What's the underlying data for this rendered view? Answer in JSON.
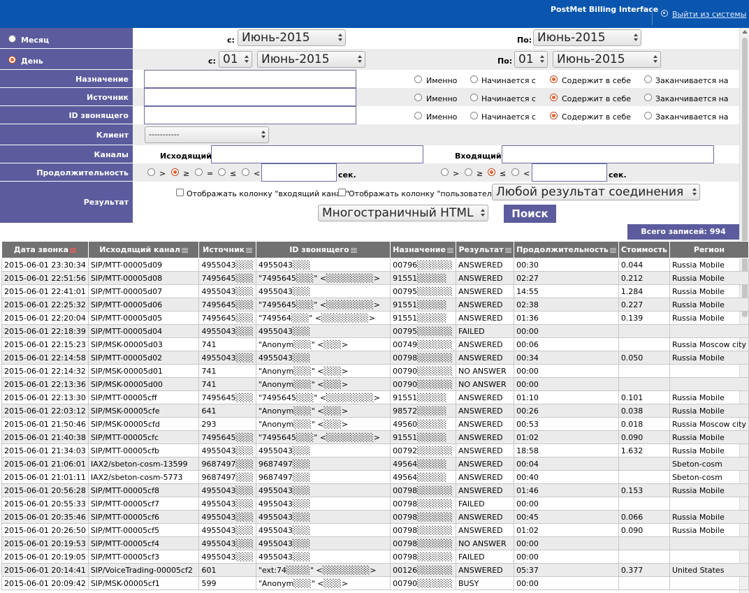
{
  "header": {
    "brand": "PostMet Billing Interface",
    "logout_label": "Выйти из системы"
  },
  "filters": {
    "month": {
      "label": "Месяц",
      "from_label": "с:",
      "from_value": "Июнь-2015",
      "to_label": "По:",
      "to_value": "Июнь-2015"
    },
    "day": {
      "label": "День",
      "from_label": "с:",
      "from_day": "01",
      "from_month": "Июнь-2015",
      "to_label": "По:",
      "to_day": "01",
      "to_month": "Июнь-2015"
    },
    "match_options": [
      "Именно",
      "Начинается с",
      "Содержит в себе",
      "Заканчивается на"
    ],
    "destination_label": "Назначение",
    "source_label": "Источник",
    "caller_id_label": "ID звонящего",
    "client_label": "Клиент",
    "client_value": "-----------",
    "channels_label": "Каналы",
    "outgoing_label": "Исходящий:",
    "incoming_label": "Входящий:",
    "duration_label": "Продолжительность",
    "duration_ops": [
      ">",
      "≥",
      "=",
      "≤",
      "<"
    ],
    "duration_ops2": [
      ">",
      "≥",
      "≤",
      "<"
    ],
    "seconds_label": "сек.",
    "result_label": "Результат",
    "show_incoming_label": "Отображать колонку \"входящий канал\"",
    "show_user_label": "Отображать колонку \"пользователь\"",
    "result_select": "Любой результат соединения",
    "format_select": "Многостраничный HTML",
    "search_button": "Поиск",
    "total_label": "Всего записей: 994"
  },
  "table": {
    "columns": [
      "Дата звонка",
      "Исходящий канал",
      "Источник",
      "ID звонящего",
      "Назначение",
      "Результат",
      "Продолжительность",
      "Стоимость",
      "Регион"
    ],
    "rows": [
      [
        "2015-06-01 23:30:34",
        "SIP/MTT-00005d09",
        "4955043░░░",
        "4955043░░░",
        "00796░░░░░░",
        "ANSWERED",
        "00:30",
        "0.044",
        "Russia Mobile"
      ],
      [
        "2015-06-01 22:51:56",
        "SIP/MTT-00005d08",
        "7495645░░░",
        "\"7495645░░░\" <░░░░░░░░>",
        "91551░░░░░",
        "ANSWERED",
        "02:27",
        "0.212",
        "Russia Mobile"
      ],
      [
        "2015-06-01 22:41:01",
        "SIP/MTT-00005d07",
        "4955043░░░",
        "4955043░░░",
        "00795░░░░░░",
        "ANSWERED",
        "14:55",
        "1.284",
        "Russia Mobile"
      ],
      [
        "2015-06-01 22:25:32",
        "SIP/MTT-00005d06",
        "7495645░░░",
        "\"7495645░░░\" <░░░░░░░░>",
        "91551░░░░░",
        "ANSWERED",
        "02:38",
        "0.227",
        "Russia Mobile"
      ],
      [
        "2015-06-01 22:20:04",
        "SIP/MTT-00005d05",
        "7495645░░░",
        "\"749564░░░\" <░░░░░░░░>",
        "91551░░░░░",
        "ANSWERED",
        "01:36",
        "0.139",
        "Russia Mobile"
      ],
      [
        "2015-06-01 22:18:39",
        "SIP/MTT-00005d04",
        "4955043░░░",
        "4955043░░░",
        "00795░░░░░░",
        "FAILED",
        "00:00",
        "",
        ""
      ],
      [
        "2015-06-01 22:15:23",
        "SIP/MSK-00005d03",
        "741",
        "\"Anonym░░░\" <░░░>",
        "00749░░░░░░",
        "ANSWERED",
        "00:06",
        "",
        "Russia Moscow city"
      ],
      [
        "2015-06-01 22:14:58",
        "SIP/MTT-00005d02",
        "4955043░░░",
        "4955043░░░",
        "00798░░░░░░",
        "ANSWERED",
        "00:34",
        "0.050",
        "Russia Mobile"
      ],
      [
        "2015-06-01 22:14:32",
        "SIP/MSK-00005d01",
        "741",
        "\"Anonym░░░\" <░░░>",
        "00790░░░░░░",
        "NO ANSWER",
        "00:00",
        "",
        ""
      ],
      [
        "2015-06-01 22:13:36",
        "SIP/MSK-00005d00",
        "741",
        "\"Anonym░░░\" <░░░>",
        "00790░░░░░░",
        "NO ANSWER",
        "00:00",
        "",
        ""
      ],
      [
        "2015-06-01 22:13:30",
        "SIP/MTT-00005cff",
        "7495645░░░",
        "\"7495645░░░\" <░░░░░░░░>",
        "91551░░░░░",
        "ANSWERED",
        "01:10",
        "0.101",
        "Russia Mobile"
      ],
      [
        "2015-06-01 22:03:12",
        "SIP/MSK-00005cfe",
        "641",
        "\"Anonym░░░\" <░░░>",
        "98572░░░░░",
        "ANSWERED",
        "00:26",
        "0.038",
        "Russia Mobile"
      ],
      [
        "2015-06-01 21:50:46",
        "SIP/MSK-00005cfd",
        "293",
        "\"Anonym░░░\" <░░░>",
        "49560░░░░░",
        "ANSWERED",
        "00:53",
        "0.018",
        "Russia Moscow city"
      ],
      [
        "2015-06-01 21:40:38",
        "SIP/MTT-00005cfc",
        "7495645░░░",
        "\"7495645░░░\" <░░░░░░░░>",
        "91551░░░░░",
        "ANSWERED",
        "01:02",
        "0.090",
        "Russia Mobile"
      ],
      [
        "2015-06-01 21:34:03",
        "SIP/MTT-00005cfb",
        "4955043░░░",
        "4955043░░░",
        "00792░░░░░░",
        "ANSWERED",
        "18:58",
        "1.632",
        "Russia Mobile"
      ],
      [
        "2015-06-01 21:06:01",
        "IAX2/sbeton-cosm-13599",
        "9687497░░░",
        "9687497░░░",
        "49564░░░░░",
        "ANSWERED",
        "00:04",
        "",
        "Sbeton-cosm"
      ],
      [
        "2015-06-01 21:01:11",
        "IAX2/sbeton-cosm-5773",
        "9687497░░░",
        "9687497░░░",
        "49564░░░░░",
        "ANSWERED",
        "00:40",
        "",
        "Sbeton-cosm"
      ],
      [
        "2015-06-01 20:56:28",
        "SIP/MTT-00005cf8",
        "4955043░░░",
        "4955043░░░",
        "00798░░░░░░",
        "ANSWERED",
        "01:46",
        "0.153",
        "Russia Mobile"
      ],
      [
        "2015-06-01 20:55:33",
        "SIP/MTT-00005cf7",
        "4955043░░░",
        "4955043░░░",
        "00798░░░░░░",
        "FAILED",
        "00:00",
        "",
        ""
      ],
      [
        "2015-06-01 20:35:46",
        "SIP/MTT-00005cf6",
        "4955043░░░",
        "4955043░░░",
        "00798░░░░░░",
        "ANSWERED",
        "00:45",
        "0.066",
        "Russia Mobile"
      ],
      [
        "2015-06-01 20:26:50",
        "SIP/MTT-00005cf5",
        "4955043░░░",
        "4955043░░░",
        "00798░░░░░░",
        "ANSWERED",
        "01:02",
        "0.090",
        "Russia Mobile"
      ],
      [
        "2015-06-01 20:19:53",
        "SIP/MTT-00005cf4",
        "4955043░░░",
        "4955043░░░",
        "00798░░░░░░",
        "NO ANSWER",
        "00:00",
        "",
        ""
      ],
      [
        "2015-06-01 20:19:05",
        "SIP/MTT-00005cf3",
        "4955043░░░",
        "4955043░░░",
        "00798░░░░░░",
        "FAILED",
        "00:00",
        "",
        ""
      ],
      [
        "2015-06-01 20:14:41",
        "SIP/VoiceTrading-00005cf2",
        "601",
        "\"ext:74░░░░\" <░░░░░░░░>",
        "00126░░░░░░",
        "ANSWERED",
        "05:37",
        "0.377",
        "United States"
      ],
      [
        "2015-06-01 20:09:42",
        "SIP/MSK-00005cf1",
        "599",
        "\"Anonym░░░\" <░░░>",
        "00790░░░░░░",
        "BUSY",
        "00:00",
        "",
        ""
      ]
    ]
  }
}
